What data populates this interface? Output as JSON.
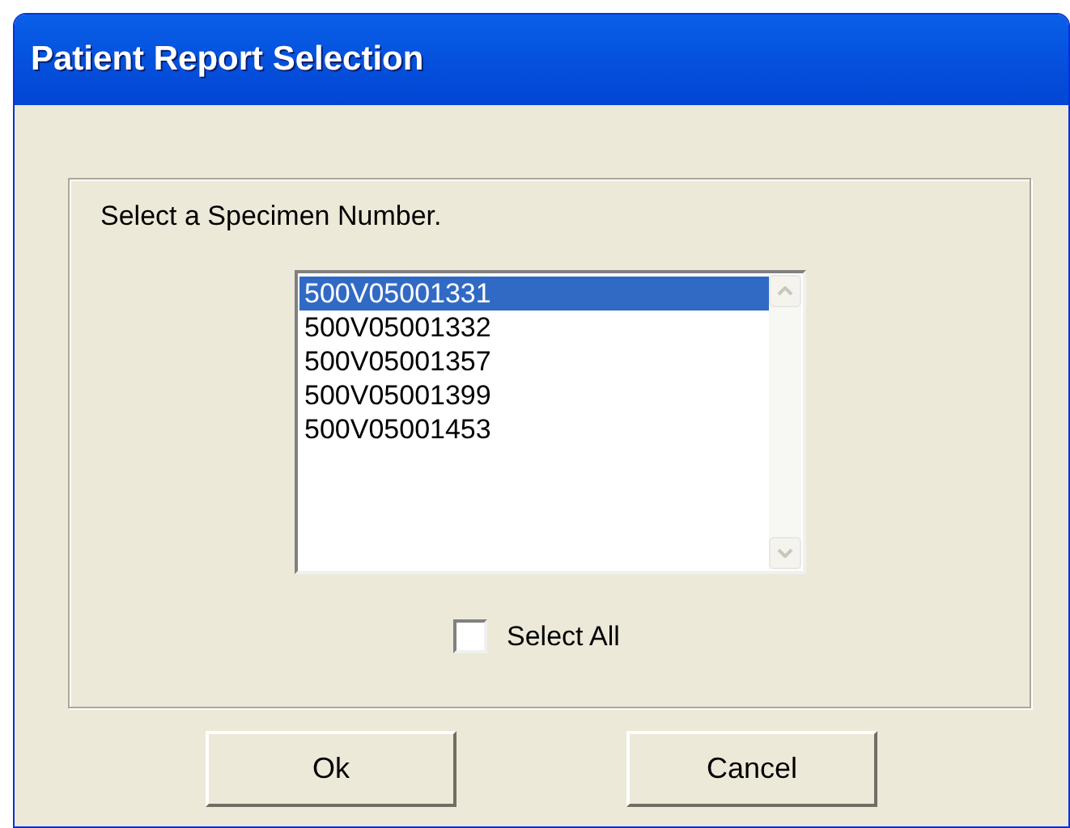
{
  "window": {
    "title": "Patient Report Selection"
  },
  "prompt": "Select a Specimen Number.",
  "specimens": [
    {
      "label": "500V05001331",
      "selected": true
    },
    {
      "label": "500V05001332",
      "selected": false
    },
    {
      "label": "500V05001357",
      "selected": false
    },
    {
      "label": "500V05001399",
      "selected": false
    },
    {
      "label": "500V05001453",
      "selected": false
    }
  ],
  "select_all": {
    "label": "Select All",
    "checked": false
  },
  "buttons": [
    {
      "label": "Ok"
    },
    {
      "label": "Cancel"
    }
  ]
}
